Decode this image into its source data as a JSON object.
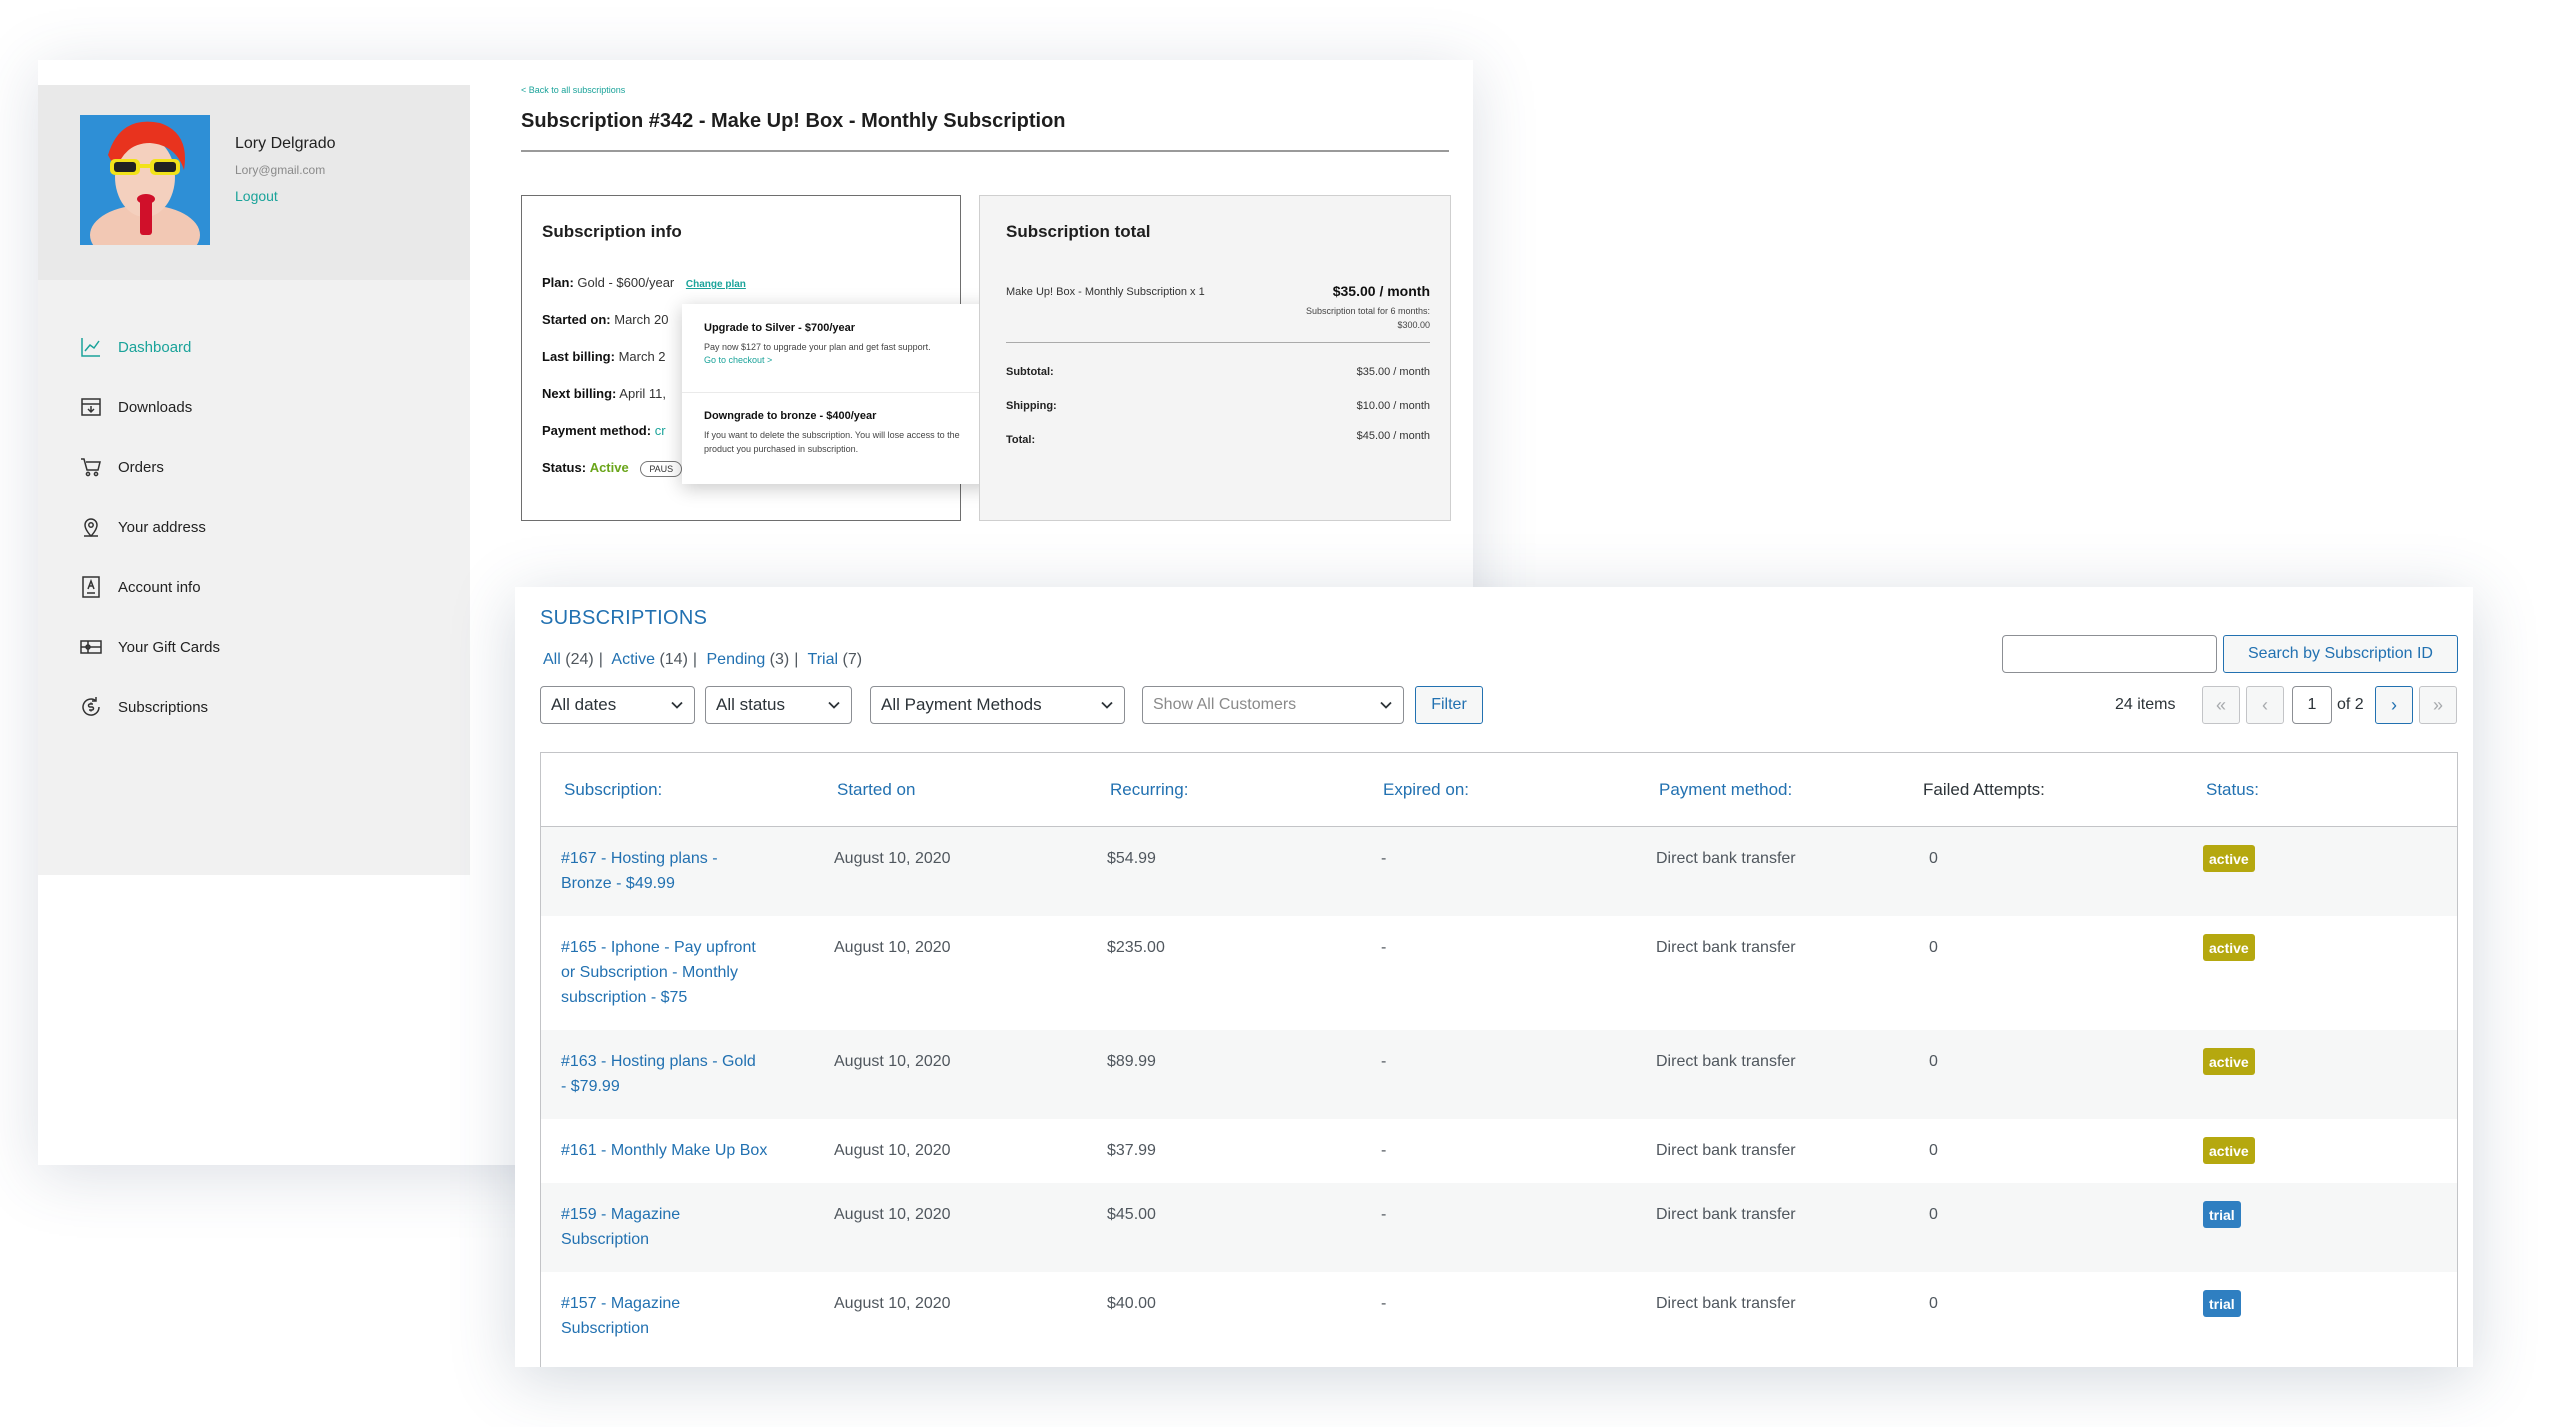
{
  "account": {
    "user": {
      "name": "Lory Delgrado",
      "email": "Lory@gmail.com",
      "logout": "Logout"
    },
    "nav": [
      {
        "label": "Dashboard",
        "icon": "chart-icon",
        "active": true
      },
      {
        "label": "Downloads",
        "icon": "download-box-icon"
      },
      {
        "label": "Orders",
        "icon": "cart-icon"
      },
      {
        "label": "Your address",
        "icon": "location-pin-icon"
      },
      {
        "label": "Account info",
        "icon": "account-card-icon"
      },
      {
        "label": "Your Gift Cards",
        "icon": "gift-card-icon"
      },
      {
        "label": "Subscriptions",
        "icon": "dollar-cycle-icon"
      }
    ],
    "back_link": "< Back to all subscriptions",
    "title": "Subscription #342 - Make Up! Box - Monthly Subscription",
    "info": {
      "heading": "Subscription info",
      "plan_label": "Plan:",
      "plan_value": "Gold - $600/year",
      "change_plan": "Change plan",
      "started_label": "Started on:",
      "started_value": "March 20",
      "last_label": "Last billing:",
      "last_value": "March 2",
      "next_label": "Next billing:",
      "next_value": "April 11,",
      "payment_label": "Payment method:",
      "payment_value": "cr",
      "status_label": "Status:",
      "status_value": "Active",
      "pause": "PAUS"
    },
    "popover": {
      "upgrade_title": "Upgrade to Silver - $700/year",
      "upgrade_desc": "Pay now $127 to upgrade your plan and get fast support.",
      "upgrade_link": "Go to checkout >",
      "downgrade_title": "Downgrade to bronze - $400/year",
      "downgrade_desc": "If you want to delete the subscription. You will lose access to the product you purchased in subscription."
    },
    "total": {
      "heading": "Subscription total",
      "item": "Make Up! Box - Monthly Subscription x 1",
      "item_price": "$35.00 / month",
      "item_note": "Subscription total for 6 months: $300.00",
      "subtotal_label": "Subtotal:",
      "subtotal": "$35.00 / month",
      "shipping_label": "Shipping:",
      "shipping": "$10.00 / month",
      "total_label": "Total:",
      "total": "$45.00 / month"
    }
  },
  "admin": {
    "heading": "SUBSCRIPTIONS",
    "views": [
      {
        "label": "All",
        "count": "(24)"
      },
      {
        "label": "Active",
        "count": "(14)"
      },
      {
        "label": "Pending",
        "count": "(3)"
      },
      {
        "label": "Trial",
        "count": "(7)"
      }
    ],
    "search_placeholder": "",
    "search_button": "Search by Subscription ID",
    "filters": {
      "dates": "All dates",
      "status": "All status",
      "payment": "All Payment Methods",
      "customers": "Show All Customers",
      "button": "Filter"
    },
    "pagination": {
      "items": "24 items",
      "first": "«",
      "prev": "‹",
      "current": "1",
      "of": "of 2",
      "next": "›",
      "last": "»"
    },
    "columns": [
      "Subscription:",
      "Started on",
      "Recurring:",
      "Expired on:",
      "Payment method:",
      "Failed Attempts:",
      "Status:"
    ],
    "status_colors": {
      "active": "#b5a80f",
      "trial": "#2f7fc1"
    },
    "rows": [
      {
        "subscription": [
          "#167 - Hosting plans -",
          "Bronze - $49.99"
        ],
        "started": "August 10, 2020",
        "recurring": "$54.99",
        "expired": "-",
        "payment": "Direct bank transfer",
        "failed": "0",
        "status": "active"
      },
      {
        "subscription": [
          "#165 - Iphone - Pay upfront",
          "or Subscription - Monthly",
          "subscription - $75"
        ],
        "started": "August 10, 2020",
        "recurring": "$235.00",
        "expired": "-",
        "payment": "Direct bank transfer",
        "failed": "0",
        "status": "active"
      },
      {
        "subscription": [
          "#163 - Hosting plans - Gold",
          "- $79.99"
        ],
        "started": "August 10, 2020",
        "recurring": "$89.99",
        "expired": "-",
        "payment": "Direct bank transfer",
        "failed": "0",
        "status": "active"
      },
      {
        "subscription": [
          "#161 - Monthly Make Up Box"
        ],
        "started": "August 10, 2020",
        "recurring": "$37.99",
        "expired": "-",
        "payment": "Direct bank transfer",
        "failed": "0",
        "status": "active"
      },
      {
        "subscription": [
          "#159 - Magazine",
          "Subscription"
        ],
        "started": "August 10, 2020",
        "recurring": "$45.00",
        "expired": "-",
        "payment": "Direct bank transfer",
        "failed": "0",
        "status": "trial"
      },
      {
        "subscription": [
          "#157 - Magazine",
          "Subscription"
        ],
        "started": "August 10, 2020",
        "recurring": "$40.00",
        "expired": "-",
        "payment": "Direct bank transfer",
        "failed": "0",
        "status": "trial"
      }
    ]
  }
}
